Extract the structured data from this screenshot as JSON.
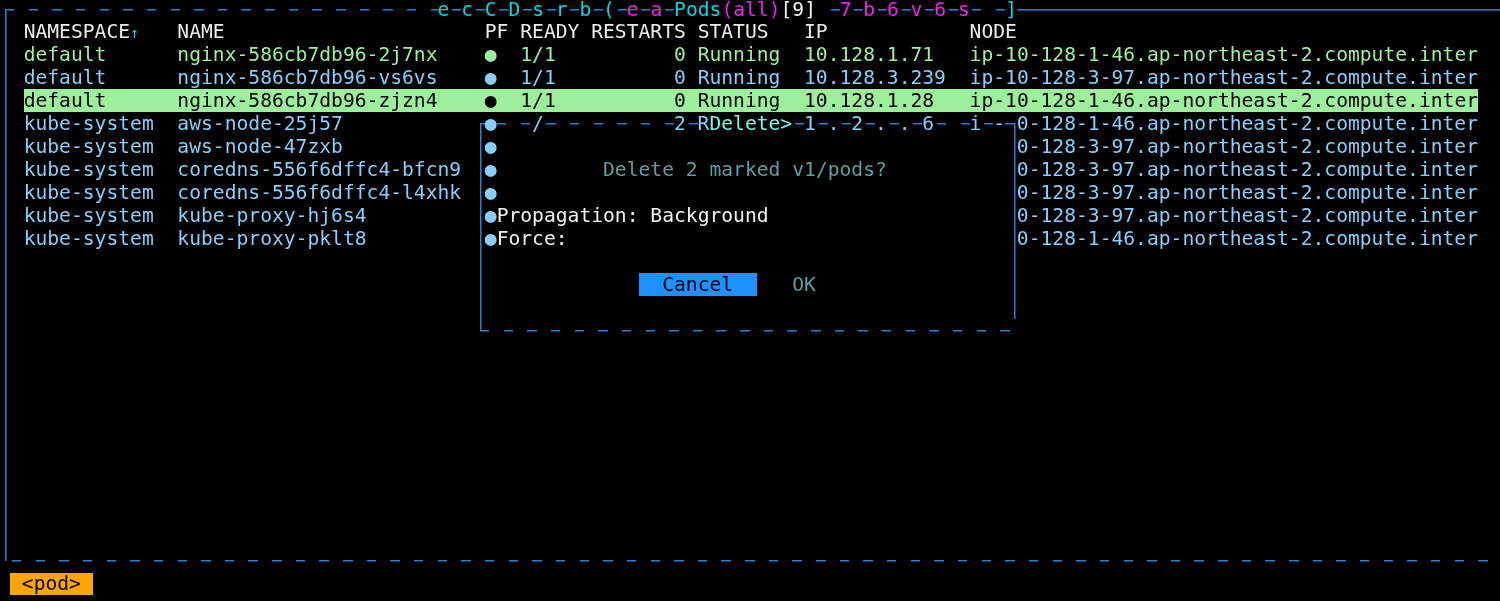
{
  "frame": {
    "title": [
      {
        "text": "e c C D s r b (",
        "color": "#00d8e8"
      },
      {
        "text": " e a",
        "color": "#f020f0"
      },
      {
        "text": " Pods",
        "color": "#00d8e8"
      },
      {
        "text": "(all)",
        "color": "#f020f0"
      },
      {
        "text": "[9]",
        "color": "#f5f5f5"
      },
      {
        "text": "  7 b 6 v 6 s",
        "color": "#f020f0"
      },
      {
        "text": "   ]",
        "color": "#00d8e8"
      }
    ]
  },
  "table": {
    "columns": [
      {
        "label": "NAMESPACE",
        "sort_indicator": "↑"
      },
      {
        "label": "NAME"
      },
      {
        "label": "PF"
      },
      {
        "label": "READY"
      },
      {
        "label": "RESTARTS"
      },
      {
        "label": "STATUS"
      },
      {
        "label": "IP"
      },
      {
        "label": "NODE"
      }
    ],
    "rows": [
      {
        "namespace": "default",
        "name": "nginx-586cb7db96-2j7nx",
        "pf": "●",
        "ready": "1/1",
        "restarts": "0",
        "status": "Running",
        "ip": "10.128.1.71",
        "node": "ip-10-128-1-46.ap-northeast-2.compute.inter",
        "color": "#9cf09c",
        "selected": false
      },
      {
        "namespace": "default",
        "name": "nginx-586cb7db96-vs6vs",
        "pf": "●",
        "ready": "1/1",
        "restarts": "0",
        "status": "Running",
        "ip": "10.128.3.239",
        "node": "ip-10-128-3-97.ap-northeast-2.compute.inter",
        "color": "#87cefa",
        "selected": false
      },
      {
        "namespace": "default",
        "name": "nginx-586cb7db96-zjzn4",
        "pf": "●",
        "ready": "1/1",
        "restarts": "0",
        "status": "Running",
        "ip": "10.128.1.28",
        "node": "ip-10-128-1-46.ap-northeast-2.compute.inter",
        "color": "#9cf09c",
        "selected": true
      },
      {
        "namespace": "kube-system",
        "name": "aws-node-25j57",
        "pf": "●",
        "node": "0-128-1-46.ap-northeast-2.compute.inter",
        "color": "#87cefa",
        "selected": false
      },
      {
        "namespace": "kube-system",
        "name": "aws-node-47zxb",
        "pf": "●",
        "node": "0-128-3-97.ap-northeast-2.compute.inter",
        "color": "#87cefa",
        "selected": false
      },
      {
        "namespace": "kube-system",
        "name": "coredns-556f6dffc4-bfcn9",
        "pf": "●",
        "node": "0-128-3-97.ap-northeast-2.compute.inter",
        "color": "#87cefa",
        "selected": false
      },
      {
        "namespace": "kube-system",
        "name": "coredns-556f6dffc4-l4xhk",
        "pf": "●",
        "node": "0-128-3-97.ap-northeast-2.compute.inter",
        "color": "#87cefa",
        "selected": false
      },
      {
        "namespace": "kube-system",
        "name": "kube-proxy-hj6s4",
        "pf": "●",
        "node": "0-128-3-97.ap-northeast-2.compute.inter",
        "color": "#87cefa",
        "selected": false
      },
      {
        "namespace": "kube-system",
        "name": "kube-proxy-pklt8",
        "pf": "●",
        "node": "0-128-1-46.ap-northeast-2.compute.inter",
        "color": "#87cefa",
        "selected": false
      }
    ]
  },
  "dialog": {
    "edge_text_left": "/           2 R",
    "title": "Delete>",
    "edge_text_right": " 1 . 2 . . 6   i -",
    "message": "Delete 2 marked v1/pods?",
    "fields": [
      {
        "label": "Propagation:",
        "value": "Background"
      },
      {
        "label": "Force:"
      }
    ],
    "buttons": [
      {
        "label": "Cancel",
        "focused": true
      },
      {
        "label": "OK",
        "focused": false
      }
    ]
  },
  "status_bar": {
    "breadcrumb": "<pod>"
  }
}
